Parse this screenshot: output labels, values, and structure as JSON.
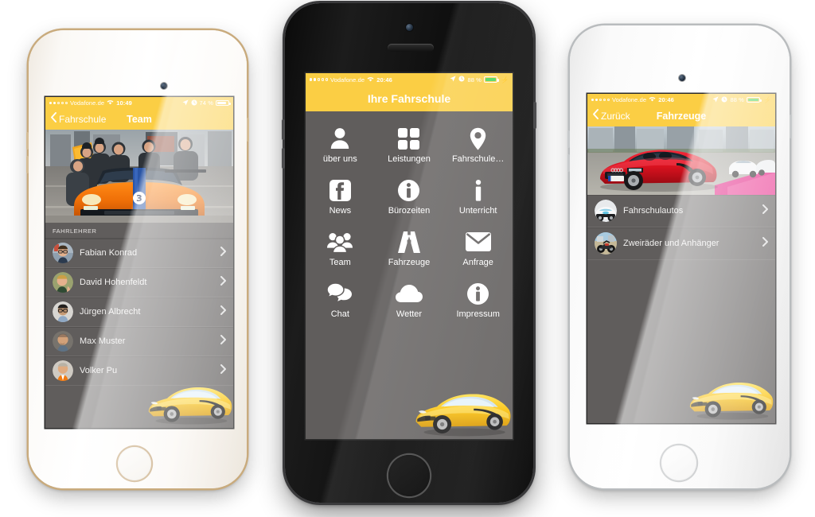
{
  "app": {
    "brand_yellow": "#fbce44",
    "screen_gray": "#605d5c",
    "battery_green": "#43d353"
  },
  "phones": [
    {
      "id": "left",
      "case": "gold-white",
      "status": {
        "carrier": "Vodafone.de",
        "signal_filled": 2,
        "signal_total": 5,
        "wifi_icon": "wifi-icon",
        "time": "10:49",
        "location_icon": "location-arrow-icon",
        "alarm_icon": "alarm-clock-icon",
        "battery_percent": "74 %",
        "battery_level": 74,
        "charging": false
      },
      "nav": {
        "back_label": "Fahrschule",
        "back_icon": "chevron-left-icon",
        "title": "Team"
      },
      "hero_image": "orange-race-car-with-pit-crew",
      "section_header": "FAHRLEHRER",
      "rows": [
        {
          "label": "Fabian Konrad",
          "avatar": "portrait-man-glasses-beard",
          "chevron": "chevron-right-icon"
        },
        {
          "label": "David Hohenfeldt",
          "avatar": "portrait-man-blond-waving",
          "chevron": "chevron-right-icon"
        },
        {
          "label": "Jürgen Albrecht",
          "avatar": "portrait-man-glasses-blue-shirt",
          "chevron": "chevron-right-icon"
        },
        {
          "label": "Max Muster",
          "avatar": "portrait-man-shaved-head",
          "chevron": "chevron-right-icon"
        },
        {
          "label": "Volker Pu",
          "avatar": "portrait-man-orange-shirt",
          "chevron": "chevron-right-icon"
        }
      ],
      "overlay_image": "yellow-ferrari-458"
    },
    {
      "id": "center",
      "case": "black-space-gray",
      "status": {
        "carrier": "Vodafone.de",
        "signal_filled": 2,
        "signal_total": 5,
        "wifi_icon": "wifi-icon",
        "time": "20:46",
        "location_icon": "location-arrow-icon",
        "alarm_icon": "alarm-clock-icon",
        "battery_percent": "88 %",
        "battery_level": 88,
        "charging": true
      },
      "nav": {
        "title": "Ihre Fahrschule"
      },
      "menu": [
        {
          "label": "über uns",
          "icon": "person-icon"
        },
        {
          "label": "Leistungen",
          "icon": "grid-squares-icon"
        },
        {
          "label": "Fahrschule…",
          "icon": "map-pin-icon"
        },
        {
          "label": "News",
          "icon": "facebook-icon"
        },
        {
          "label": "Bürozeiten",
          "icon": "info-circle-icon"
        },
        {
          "label": "Unterricht",
          "icon": "info-letter-icon"
        },
        {
          "label": "Team",
          "icon": "people-group-icon"
        },
        {
          "label": "Fahrzeuge",
          "icon": "road-icon"
        },
        {
          "label": "Anfrage",
          "icon": "envelope-icon"
        },
        {
          "label": "Chat",
          "icon": "speech-bubbles-icon"
        },
        {
          "label": "Wetter",
          "icon": "cloud-icon"
        },
        {
          "label": "Impressum",
          "icon": "info-circle-icon"
        }
      ],
      "overlay_image": "yellow-ferrari-458"
    },
    {
      "id": "right",
      "case": "silver-white",
      "status": {
        "carrier": "Vodafone.de",
        "signal_filled": 2,
        "signal_total": 5,
        "wifi_icon": "wifi-icon",
        "time": "20:46",
        "location_icon": "location-arrow-icon",
        "alarm_icon": "alarm-clock-icon",
        "battery_percent": "88 %",
        "battery_level": 88,
        "charging": true
      },
      "nav": {
        "back_label": "Zurück",
        "back_icon": "chevron-left-icon",
        "title": "Fahrzeuge"
      },
      "hero_image": "red-audi-r8-spyder-on-track",
      "rows": [
        {
          "label": "Fahrschulautos",
          "avatar": "white-sports-car-thumb",
          "chevron": "chevron-right-icon"
        },
        {
          "label": "Zweiräder und Anhänger",
          "avatar": "motorcycle-trailer-thumb",
          "chevron": "chevron-right-icon"
        }
      ],
      "overlay_image": "yellow-ferrari-458"
    }
  ]
}
